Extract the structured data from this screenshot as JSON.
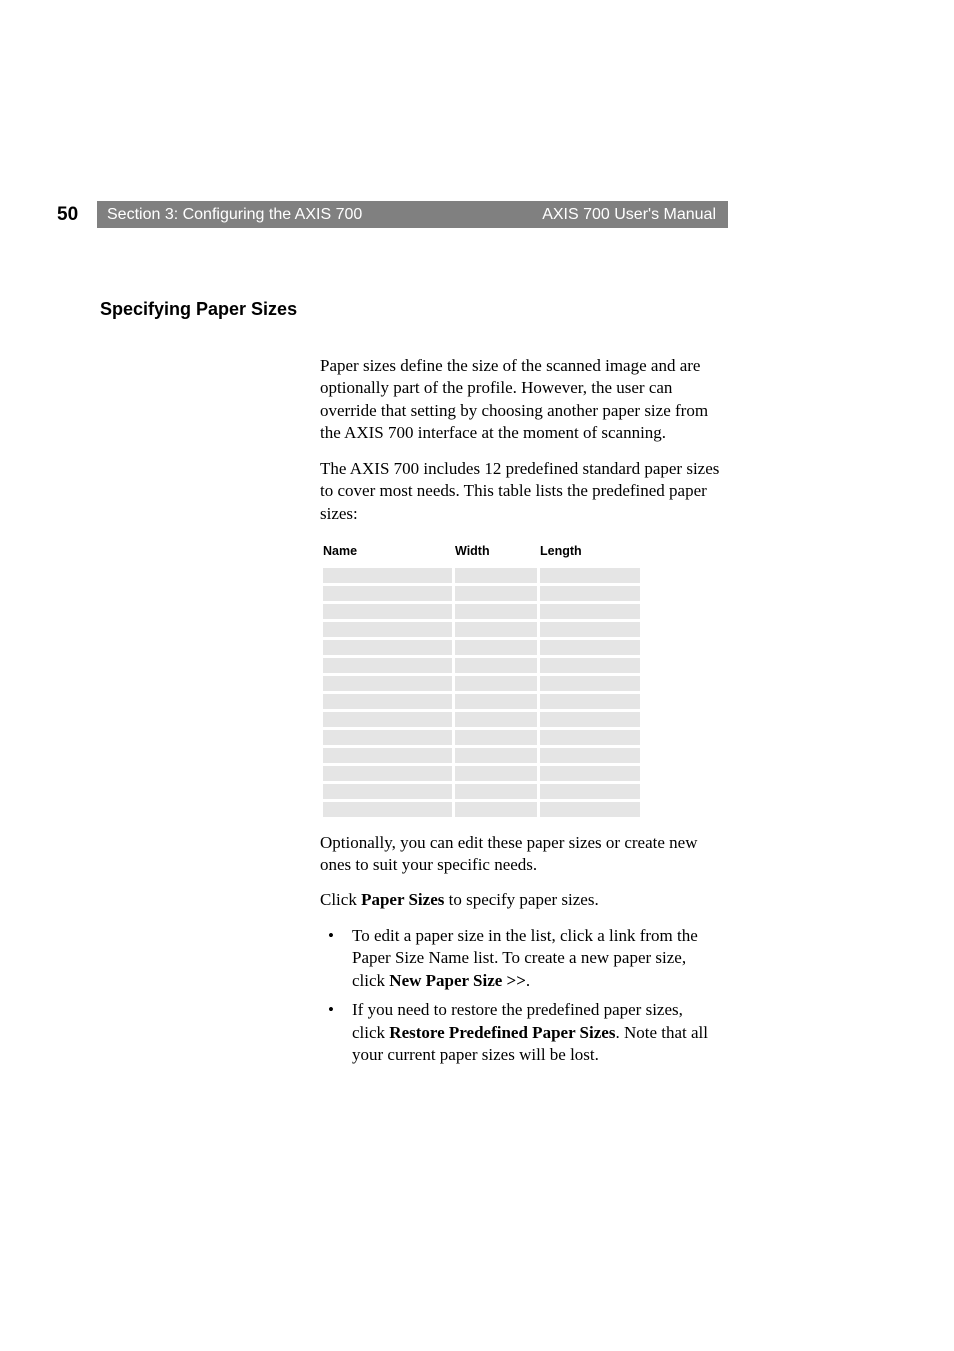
{
  "header": {
    "page_number": "50",
    "section_left": "Section 3: Configuring the AXIS 700",
    "section_right": "AXIS 700 User's Manual"
  },
  "section_title": "Specifying Paper Sizes",
  "paragraphs": {
    "p1": "Paper sizes define the size of the scanned image and are optionally part of the profile. However, the user can override that setting by choosing another paper size from the AXIS 700 interface at the moment of scanning.",
    "p2": "The AXIS 700 includes 12 predefined standard paper sizes to cover most needs. This table lists the predefined paper sizes:",
    "p3": "Optionally, you can edit these paper sizes or create new ones to suit your specific needs.",
    "p4_pre": "Click ",
    "p4_bold": "Paper Sizes",
    "p4_post": " to specify paper sizes."
  },
  "table": {
    "headers": {
      "name": "Name",
      "width": "Width",
      "length": "Length"
    },
    "rows": [
      {
        "name": "",
        "width": "",
        "length": ""
      },
      {
        "name": "",
        "width": "",
        "length": ""
      },
      {
        "name": "",
        "width": "",
        "length": ""
      },
      {
        "name": "",
        "width": "",
        "length": ""
      },
      {
        "name": "",
        "width": "",
        "length": ""
      },
      {
        "name": "",
        "width": "",
        "length": ""
      },
      {
        "name": "",
        "width": "",
        "length": ""
      },
      {
        "name": "",
        "width": "",
        "length": ""
      },
      {
        "name": "",
        "width": "",
        "length": ""
      },
      {
        "name": "",
        "width": "",
        "length": ""
      },
      {
        "name": "",
        "width": "",
        "length": ""
      },
      {
        "name": "",
        "width": "",
        "length": ""
      },
      {
        "name": "",
        "width": "",
        "length": ""
      },
      {
        "name": "",
        "width": "",
        "length": ""
      }
    ]
  },
  "bullets": {
    "b1_a": "To edit a paper size in the list, click a link from the Paper Size Name list. To create a new paper size, click ",
    "b1_bold": "New Paper Size >>",
    "b1_c": ".",
    "b2_a": "If you need to restore the predefined paper sizes, click ",
    "b2_bold1": "Restore Predefined Paper Sizes",
    "b2_b": ". Note that all your current paper sizes will be lost."
  }
}
